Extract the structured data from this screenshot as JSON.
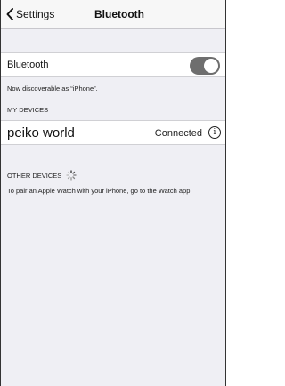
{
  "navbar": {
    "back_label": "Settings",
    "title": "Bluetooth"
  },
  "bluetooth": {
    "label": "Bluetooth",
    "enabled": true
  },
  "discoverable_text": "Now discoverable as “iPhone”.",
  "my_devices": {
    "header": "MY DEVICES",
    "items": [
      {
        "name": "peiko world",
        "status": "Connected",
        "icon": "info-icon"
      }
    ]
  },
  "other_devices": {
    "header": "OTHER DEVICES",
    "icon": "activity-spinner-icon"
  },
  "watch_note": "To pair an Apple Watch with your iPhone, go to the Watch app.",
  "colors": {
    "toggle_on": "#6e6e6e",
    "background": "#efeff4"
  }
}
